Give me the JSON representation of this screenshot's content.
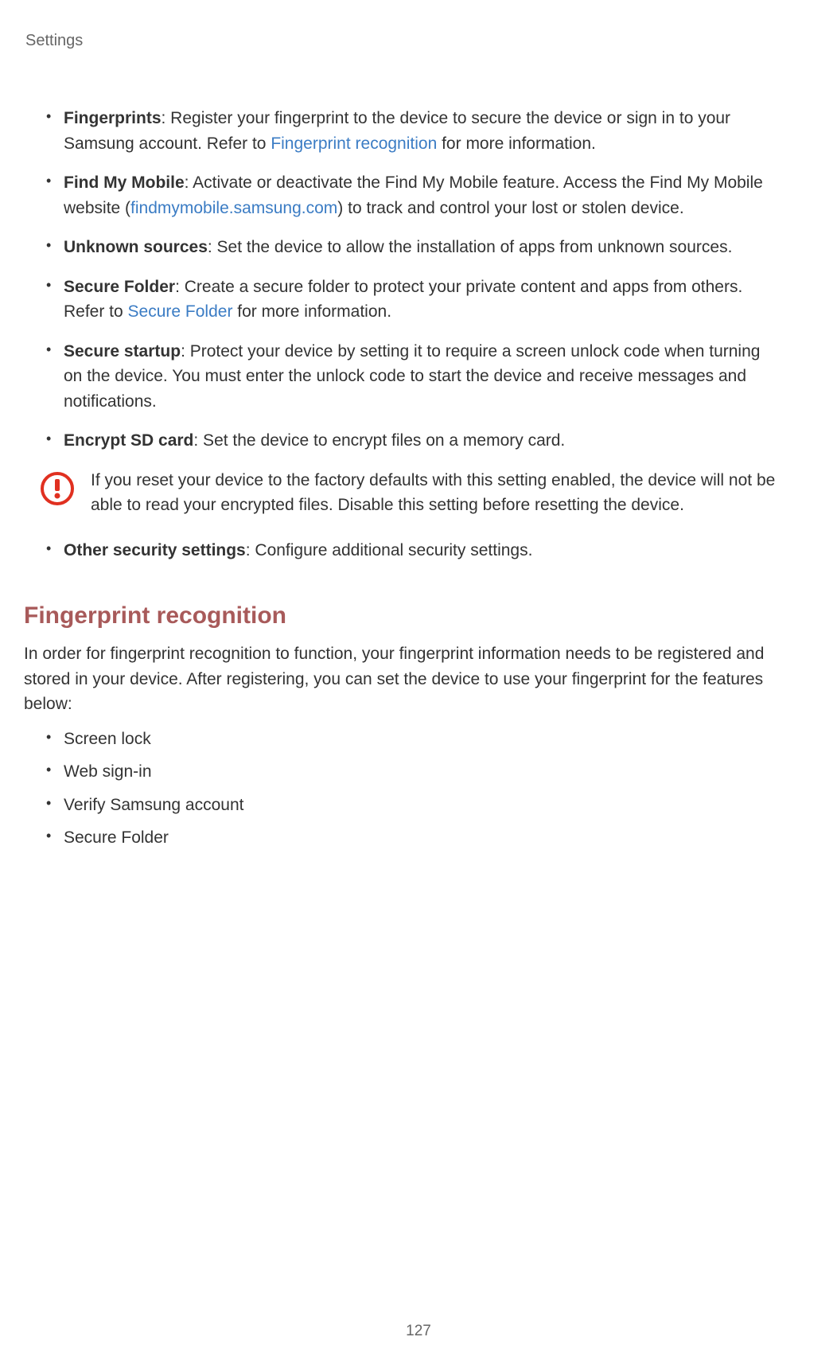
{
  "header": {
    "title": "Settings"
  },
  "bullets": {
    "fingerprints": {
      "title": "Fingerprints",
      "text1": ": Register your fingerprint to the device to secure the device or sign in to your Samsung account. Refer to ",
      "link": "Fingerprint recognition",
      "text2": " for more information."
    },
    "findmymobile": {
      "title": "Find My Mobile",
      "text1": ": Activate or deactivate the Find My Mobile feature. Access the Find My Mobile website (",
      "link": "findmymobile.samsung.com",
      "text2": ") to track and control your lost or stolen device."
    },
    "unknownsources": {
      "title": "Unknown sources",
      "text": ": Set the device to allow the installation of apps from unknown sources."
    },
    "securefolder": {
      "title": "Secure Folder",
      "text1": ": Create a secure folder to protect your private content and apps from others. Refer to ",
      "link": "Secure Folder",
      "text2": " for more information."
    },
    "securestartup": {
      "title": "Secure startup",
      "text": ": Protect your device by setting it to require a screen unlock code when turning on the device. You must enter the unlock code to start the device and receive messages and notifications."
    },
    "encryptsd": {
      "title": "Encrypt SD card",
      "text": ": Set the device to encrypt files on a memory card."
    },
    "othersecurity": {
      "title": "Other security settings",
      "text": ": Configure additional security settings."
    }
  },
  "notice": {
    "text": "If you reset your device to the factory defaults with this setting enabled, the device will not be able to read your encrypted files. Disable this setting before resetting the device."
  },
  "section": {
    "heading": "Fingerprint recognition",
    "intro": "In order for fingerprint recognition to function, your fingerprint information needs to be registered and stored in your device. After registering, you can set the device to use your fingerprint for the features below:",
    "items": {
      "item1": "Screen lock",
      "item2": "Web sign-in",
      "item3": "Verify Samsung account",
      "item4": "Secure Folder"
    }
  },
  "pageNumber": "127"
}
